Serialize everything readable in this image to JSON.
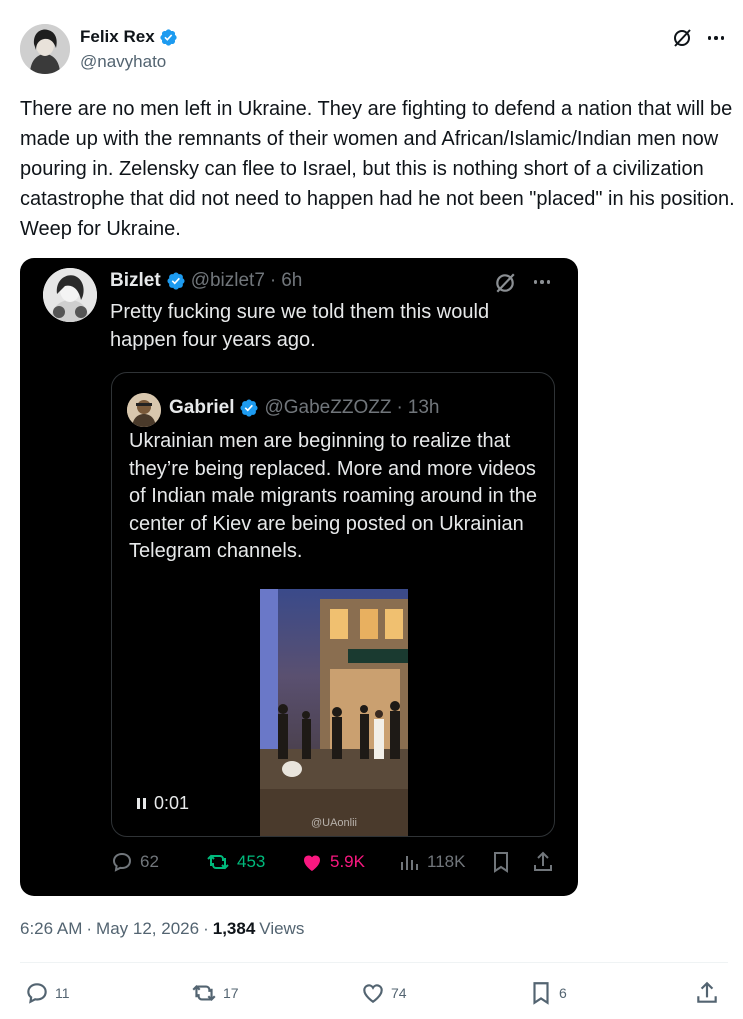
{
  "author": {
    "display_name": "Felix Rex",
    "handle": "@navyhato",
    "avatar_icon": "avatar-photo",
    "verified_color": "#1d9bf0"
  },
  "tweet": {
    "text": "There are no men left in Ukraine. They are fighting to defend a nation that will be made up with the remnants of their women and African/Islamic/Indian men now pouring in. Zelensky can flee to Israel, but this is nothing short of a civilization catastrophe that did not need to happen had he not been \"placed\" in his position. Weep for Ukraine.",
    "time": "6:26 AM",
    "date": "May 12, 2026",
    "views_count": "1,384",
    "views_label": "Views"
  },
  "quoted_screenshot": {
    "display_name": "Bizlet",
    "handle": "@bizlet7",
    "age": "6h",
    "text": "Pretty fucking sure we told them this would happen four years ago.",
    "inner": {
      "display_name": "Gabriel",
      "handle": "@GabeZZOZZ",
      "age": "13h",
      "text": "Ukrainian men are beginning to realize that they’re being replaced. More and more videos of Indian male migrants roaming around in the center of Kiev are being posted on Ukrainian Telegram channels.",
      "video_time": "0:01",
      "video_watermark": "@UAonlii"
    },
    "stats": {
      "replies": "62",
      "reposts": "453",
      "likes": "5.9K",
      "views": "118K"
    },
    "colors": {
      "repost": "#00ba7c",
      "like": "#f91880"
    }
  },
  "actions": {
    "replies": "11",
    "reposts": "17",
    "likes": "74",
    "bookmarks": "6"
  },
  "separator": "·"
}
